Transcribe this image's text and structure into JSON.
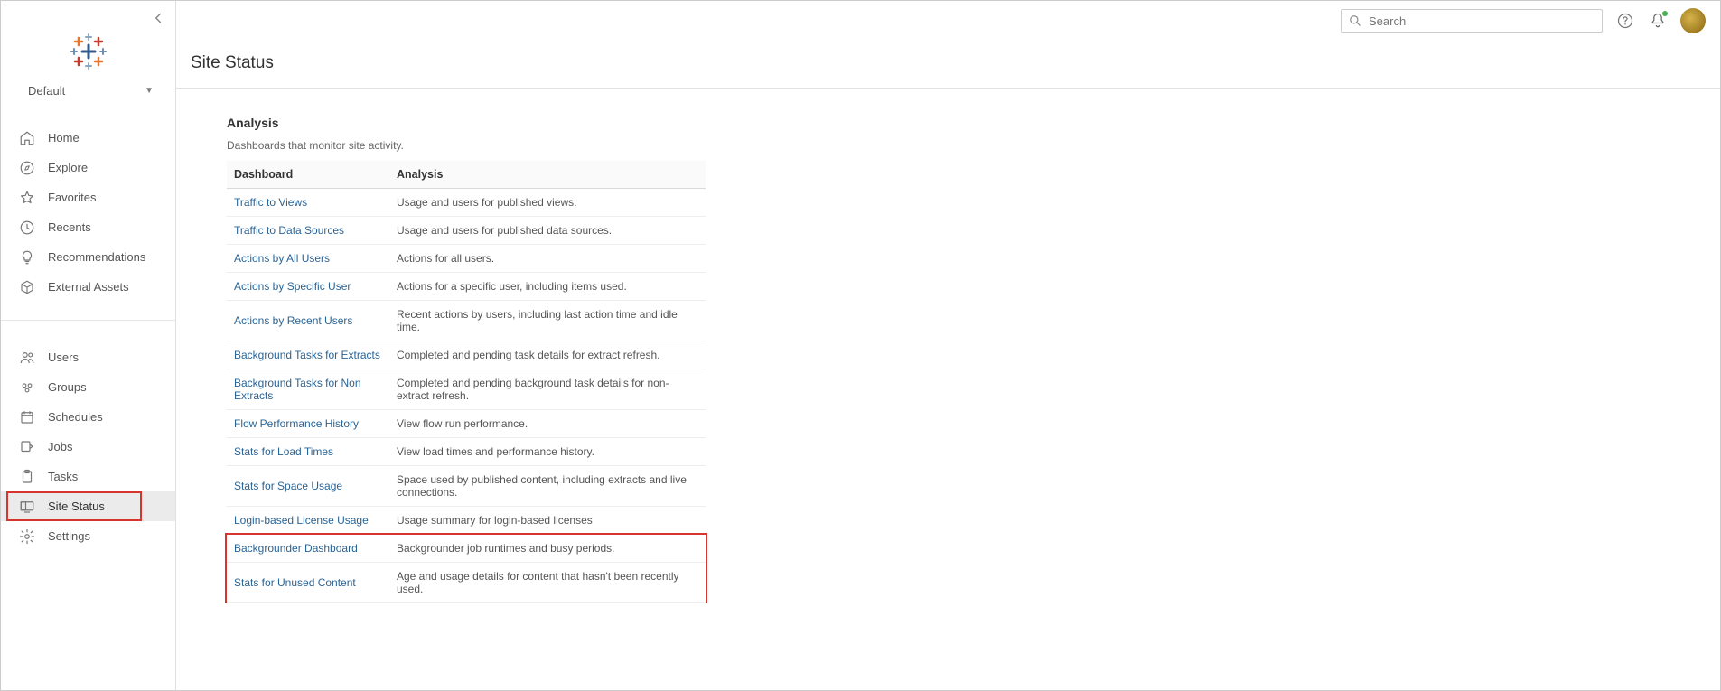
{
  "sidebar": {
    "site_label": "Default",
    "nav_primary": [
      {
        "icon": "home-icon",
        "label": "Home"
      },
      {
        "icon": "compass-icon",
        "label": "Explore"
      },
      {
        "icon": "star-icon",
        "label": "Favorites"
      },
      {
        "icon": "clock-icon",
        "label": "Recents"
      },
      {
        "icon": "bulb-icon",
        "label": "Recommendations"
      },
      {
        "icon": "cube-icon",
        "label": "External Assets"
      }
    ],
    "nav_admin": [
      {
        "icon": "users-icon",
        "label": "Users"
      },
      {
        "icon": "groups-icon",
        "label": "Groups"
      },
      {
        "icon": "calendar-icon",
        "label": "Schedules"
      },
      {
        "icon": "jobs-icon",
        "label": "Jobs"
      },
      {
        "icon": "clipboard-icon",
        "label": "Tasks"
      },
      {
        "icon": "sitestatus-icon",
        "label": "Site Status",
        "active": true
      },
      {
        "icon": "gear-icon",
        "label": "Settings"
      }
    ]
  },
  "topbar": {
    "search_placeholder": "Search"
  },
  "page": {
    "title": "Site Status",
    "section_title": "Analysis",
    "section_subtitle": "Dashboards that monitor site activity.",
    "columns": {
      "dashboard": "Dashboard",
      "analysis": "Analysis"
    },
    "rows": [
      {
        "dashboard": "Traffic to Views",
        "analysis": "Usage and users for published views."
      },
      {
        "dashboard": "Traffic to Data Sources",
        "analysis": "Usage and users for published data sources."
      },
      {
        "dashboard": "Actions by All Users",
        "analysis": "Actions for all users."
      },
      {
        "dashboard": "Actions by Specific User",
        "analysis": "Actions for a specific user, including items used."
      },
      {
        "dashboard": "Actions by Recent Users",
        "analysis": "Recent actions by users, including last action time and idle time."
      },
      {
        "dashboard": "Background Tasks for Extracts",
        "analysis": "Completed and pending task details for extract refresh."
      },
      {
        "dashboard": "Background Tasks for Non Extracts",
        "analysis": "Completed and pending background task details for non-extract refresh."
      },
      {
        "dashboard": "Flow Performance History",
        "analysis": "View flow run performance."
      },
      {
        "dashboard": "Stats for Load Times",
        "analysis": "View load times and performance history."
      },
      {
        "dashboard": "Stats for Space Usage",
        "analysis": "Space used by published content, including extracts and live connections."
      },
      {
        "dashboard": "Login-based License Usage",
        "analysis": "Usage summary for login-based licenses"
      },
      {
        "dashboard": "Backgrounder Dashboard",
        "analysis": "Backgrounder job runtimes and busy periods."
      },
      {
        "dashboard": "Stats for Unused Content",
        "analysis": "Age and usage details for content that hasn't been recently used."
      }
    ]
  }
}
